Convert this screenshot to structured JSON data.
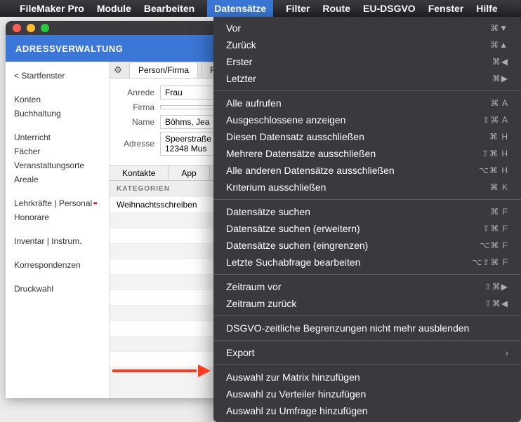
{
  "menubar": {
    "apple": "",
    "app": "FileMaker Pro",
    "items": [
      "Module",
      "Bearbeiten",
      "Datensätze",
      "Filter",
      "Route",
      "EU-DSGVO",
      "Fenster",
      "Hilfe"
    ],
    "active": "Datensätze"
  },
  "window": {
    "title": "ADRESSVERWALTUNG",
    "tool_icons": [
      "print-icon",
      "mail-icon"
    ]
  },
  "sidebar": {
    "back": "< Startfenster",
    "groups": [
      [
        "Konten",
        "Buchhaltung"
      ],
      [
        "Unterricht",
        "Fächer",
        "Veranstaltungsorte",
        "Areale"
      ],
      [
        "Lehrkräfte | Personal",
        "Honorare"
      ],
      [
        "Inventar | Instrum."
      ],
      [
        "Korrespondenzen"
      ],
      [
        "Druckwahl"
      ]
    ],
    "dots_item": "Lehrkräfte | Personal"
  },
  "tabs1": {
    "gear": "⚙",
    "tabs": [
      "Person/Firma",
      "R"
    ]
  },
  "form": {
    "rows": [
      {
        "label": "Anrede",
        "value": "Frau"
      },
      {
        "label": "Firma",
        "value": ""
      },
      {
        "label": "Name",
        "value": "Böhms, Jea"
      },
      {
        "label": "Adresse",
        "value": "Speerstraße\n12348 Mus"
      }
    ]
  },
  "tabs2": [
    "Kontakte",
    "App"
  ],
  "kategorien_label": "KATEGORIEN",
  "list": [
    "Weihnachtsschreiben"
  ],
  "menu": {
    "groups": [
      [
        {
          "label": "Vor",
          "shortcut": "⌘▼"
        },
        {
          "label": "Zurück",
          "shortcut": "⌘▲"
        },
        {
          "label": "Erster",
          "shortcut": "⌘◀"
        },
        {
          "label": "Letzter",
          "shortcut": "⌘▶"
        }
      ],
      [
        {
          "label": "Alle aufrufen",
          "shortcut": "⌘ A"
        },
        {
          "label": "Ausgeschlossene anzeigen",
          "shortcut": "⇧⌘ A"
        },
        {
          "label": "Diesen Datensatz ausschließen",
          "shortcut": "⌘ H"
        },
        {
          "label": "Mehrere Datensätze ausschließen",
          "shortcut": "⇧⌘ H"
        },
        {
          "label": "Alle anderen Datensätze ausschließen",
          "shortcut": "⌥⌘ H"
        },
        {
          "label": "Kriterium ausschließen",
          "shortcut": "⌘ K"
        }
      ],
      [
        {
          "label": "Datensätze suchen",
          "shortcut": "⌘ F"
        },
        {
          "label": "Datensätze suchen (erweitern)",
          "shortcut": "⇧⌘ F"
        },
        {
          "label": "Datensätze suchen (eingrenzen)",
          "shortcut": "⌥⌘ F"
        },
        {
          "label": "Letzte Suchabfrage bearbeiten",
          "shortcut": "⌥⇧⌘ F"
        }
      ],
      [
        {
          "label": "Zeitraum vor",
          "shortcut": "⇧⌘▶"
        },
        {
          "label": "Zeitraum zurück",
          "shortcut": "⇧⌘◀"
        }
      ],
      [
        {
          "label": "DSGVO-zeitliche Begrenzungen nicht mehr ausblenden",
          "shortcut": ""
        }
      ],
      [
        {
          "label": "Export",
          "shortcut": "",
          "submenu": true
        }
      ],
      [
        {
          "label": "Auswahl zur Matrix hinzufügen",
          "shortcut": ""
        },
        {
          "label": "Auswahl zu Verteiler hinzufügen",
          "shortcut": ""
        },
        {
          "label": "Auswahl zu Umfrage hinzufügen",
          "shortcut": ""
        }
      ]
    ]
  },
  "arrow_target": "Auswahl zu Verteiler hinzufügen"
}
